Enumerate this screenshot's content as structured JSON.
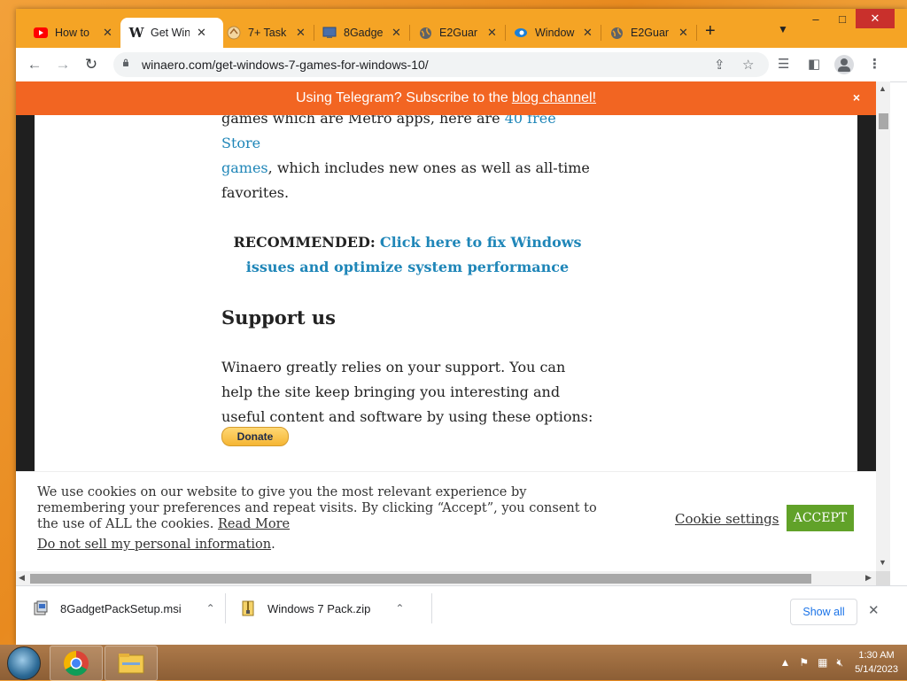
{
  "browser": {
    "tabs": [
      {
        "title": "How to",
        "icon": "youtube-icon",
        "active": false
      },
      {
        "title": "Get Win",
        "icon": "winaero-icon",
        "active": true
      },
      {
        "title": "7+ Task",
        "icon": "taskbar-tweaker-icon",
        "active": false
      },
      {
        "title": "8Gadge",
        "icon": "gadget-pack-icon",
        "active": false
      },
      {
        "title": "E2Guar",
        "icon": "globe-icon",
        "active": false
      },
      {
        "title": "Window",
        "icon": "edge-icon",
        "active": false
      },
      {
        "title": "E2Guar",
        "icon": "globe-icon",
        "active": false
      }
    ],
    "new_tab": "+",
    "window_controls": {
      "minimize": "–",
      "maximize": "□",
      "close": "✕"
    },
    "url": "winaero.com/get-windows-7-games-for-windows-10/"
  },
  "banner": {
    "text": "Using Telegram? Subscribe to the",
    "link": "blog channel!",
    "close": "×",
    "color": "#f26522"
  },
  "article": {
    "intro_prefix": "games which are Metro apps, here are",
    "intro_link1": "40 free Store",
    "intro_link2": "games",
    "intro_suffix": ", which includes new ones as well as all-time favorites.",
    "recommended_label": "RECOMMENDED:",
    "recommended_link": "Click here to fix Windows issues and optimize system performance",
    "support_heading": "Support us",
    "support_text": "Winaero greatly relies on your support. You can help the site keep bringing you interesting and useful content and software by using these options:",
    "donate_label": "Donate"
  },
  "cookie": {
    "text": "We use cookies on our website to give you the most relevant experience by remembering your preferences and repeat visits. By clicking “Accept”, you consent to the use of ALL the cookies.",
    "read_more": "Read More",
    "do_not_sell": "Do not sell my personal information",
    "settings": "Cookie settings",
    "accept": "ACCEPT",
    "accept_color": "#61a229"
  },
  "downloads": {
    "items": [
      {
        "name": "8GadgetPackSetup.msi",
        "icon": "msi-file-icon"
      },
      {
        "name": "Windows 7 Pack.zip",
        "icon": "zip-file-icon"
      }
    ],
    "show_all": "Show all",
    "close": "✕"
  },
  "taskbar": {
    "time": "1:30 AM",
    "date": "5/14/2023"
  }
}
